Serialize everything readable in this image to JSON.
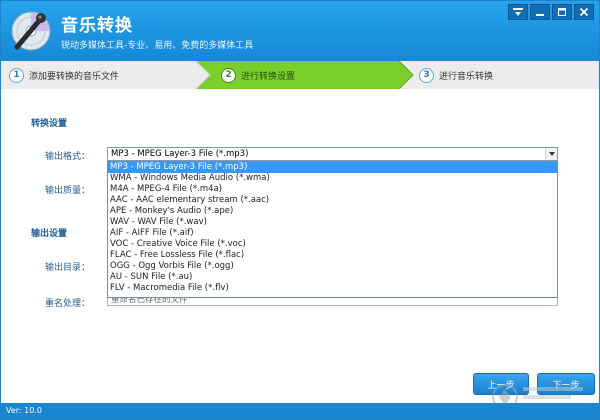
{
  "window": {
    "title": "音乐转换",
    "subtitle": "锐动多媒体工具-专业、易用、免费的多媒体工具",
    "colors": {
      "titlebar": "#1e95e0",
      "statusbar": "#1a86d2",
      "accent": "#2b78b5",
      "active_step": "#7ccf2b",
      "selected_item": "#3399ff"
    }
  },
  "window_controls": [
    "menu-icon",
    "minimize-icon",
    "maximize-icon",
    "close-icon"
  ],
  "steps": [
    {
      "num": "1",
      "label": "添加要转换的音乐文件",
      "active": false
    },
    {
      "num": "2",
      "label": "进行转换设置",
      "active": true
    },
    {
      "num": "3",
      "label": "进行音乐转换",
      "active": false
    }
  ],
  "conversion": {
    "section_title": "转换设置",
    "format_label": "输出格式：",
    "format_value": "MP3 - MPEG Layer-3 File (*.mp3)",
    "quality_label": "输出质量："
  },
  "output": {
    "section_title": "输出设置",
    "dir_label": "输出目录：",
    "rename_label": "重名处理：",
    "rename_value": "重命名已存在的文件"
  },
  "format_options": [
    "MP3 - MPEG Layer-3 File (*.mp3)",
    "WMA - Windows Media Audio (*.wma)",
    "M4A - MPEG-4 File (*.m4a)",
    "AAC - AAC elementary stream (*.aac)",
    "APE - Monkey's Audio (*.ape)",
    "WAV - WAV File (*.wav)",
    "AIF - AIFF File (*.aif)",
    "VOC - Creative Voice File (*.voc)",
    "FLAC - Free Lossless File (*.flac)",
    "OGG - Ogg Vorbis File (*.ogg)",
    "AU - SUN File (*.au)",
    "FLV - Macromedia File (*.flv)"
  ],
  "selected_option_index": 0,
  "buttons": {
    "prev": "上一步",
    "next": "下一步"
  },
  "status": {
    "version": "Ver: 10.0"
  }
}
